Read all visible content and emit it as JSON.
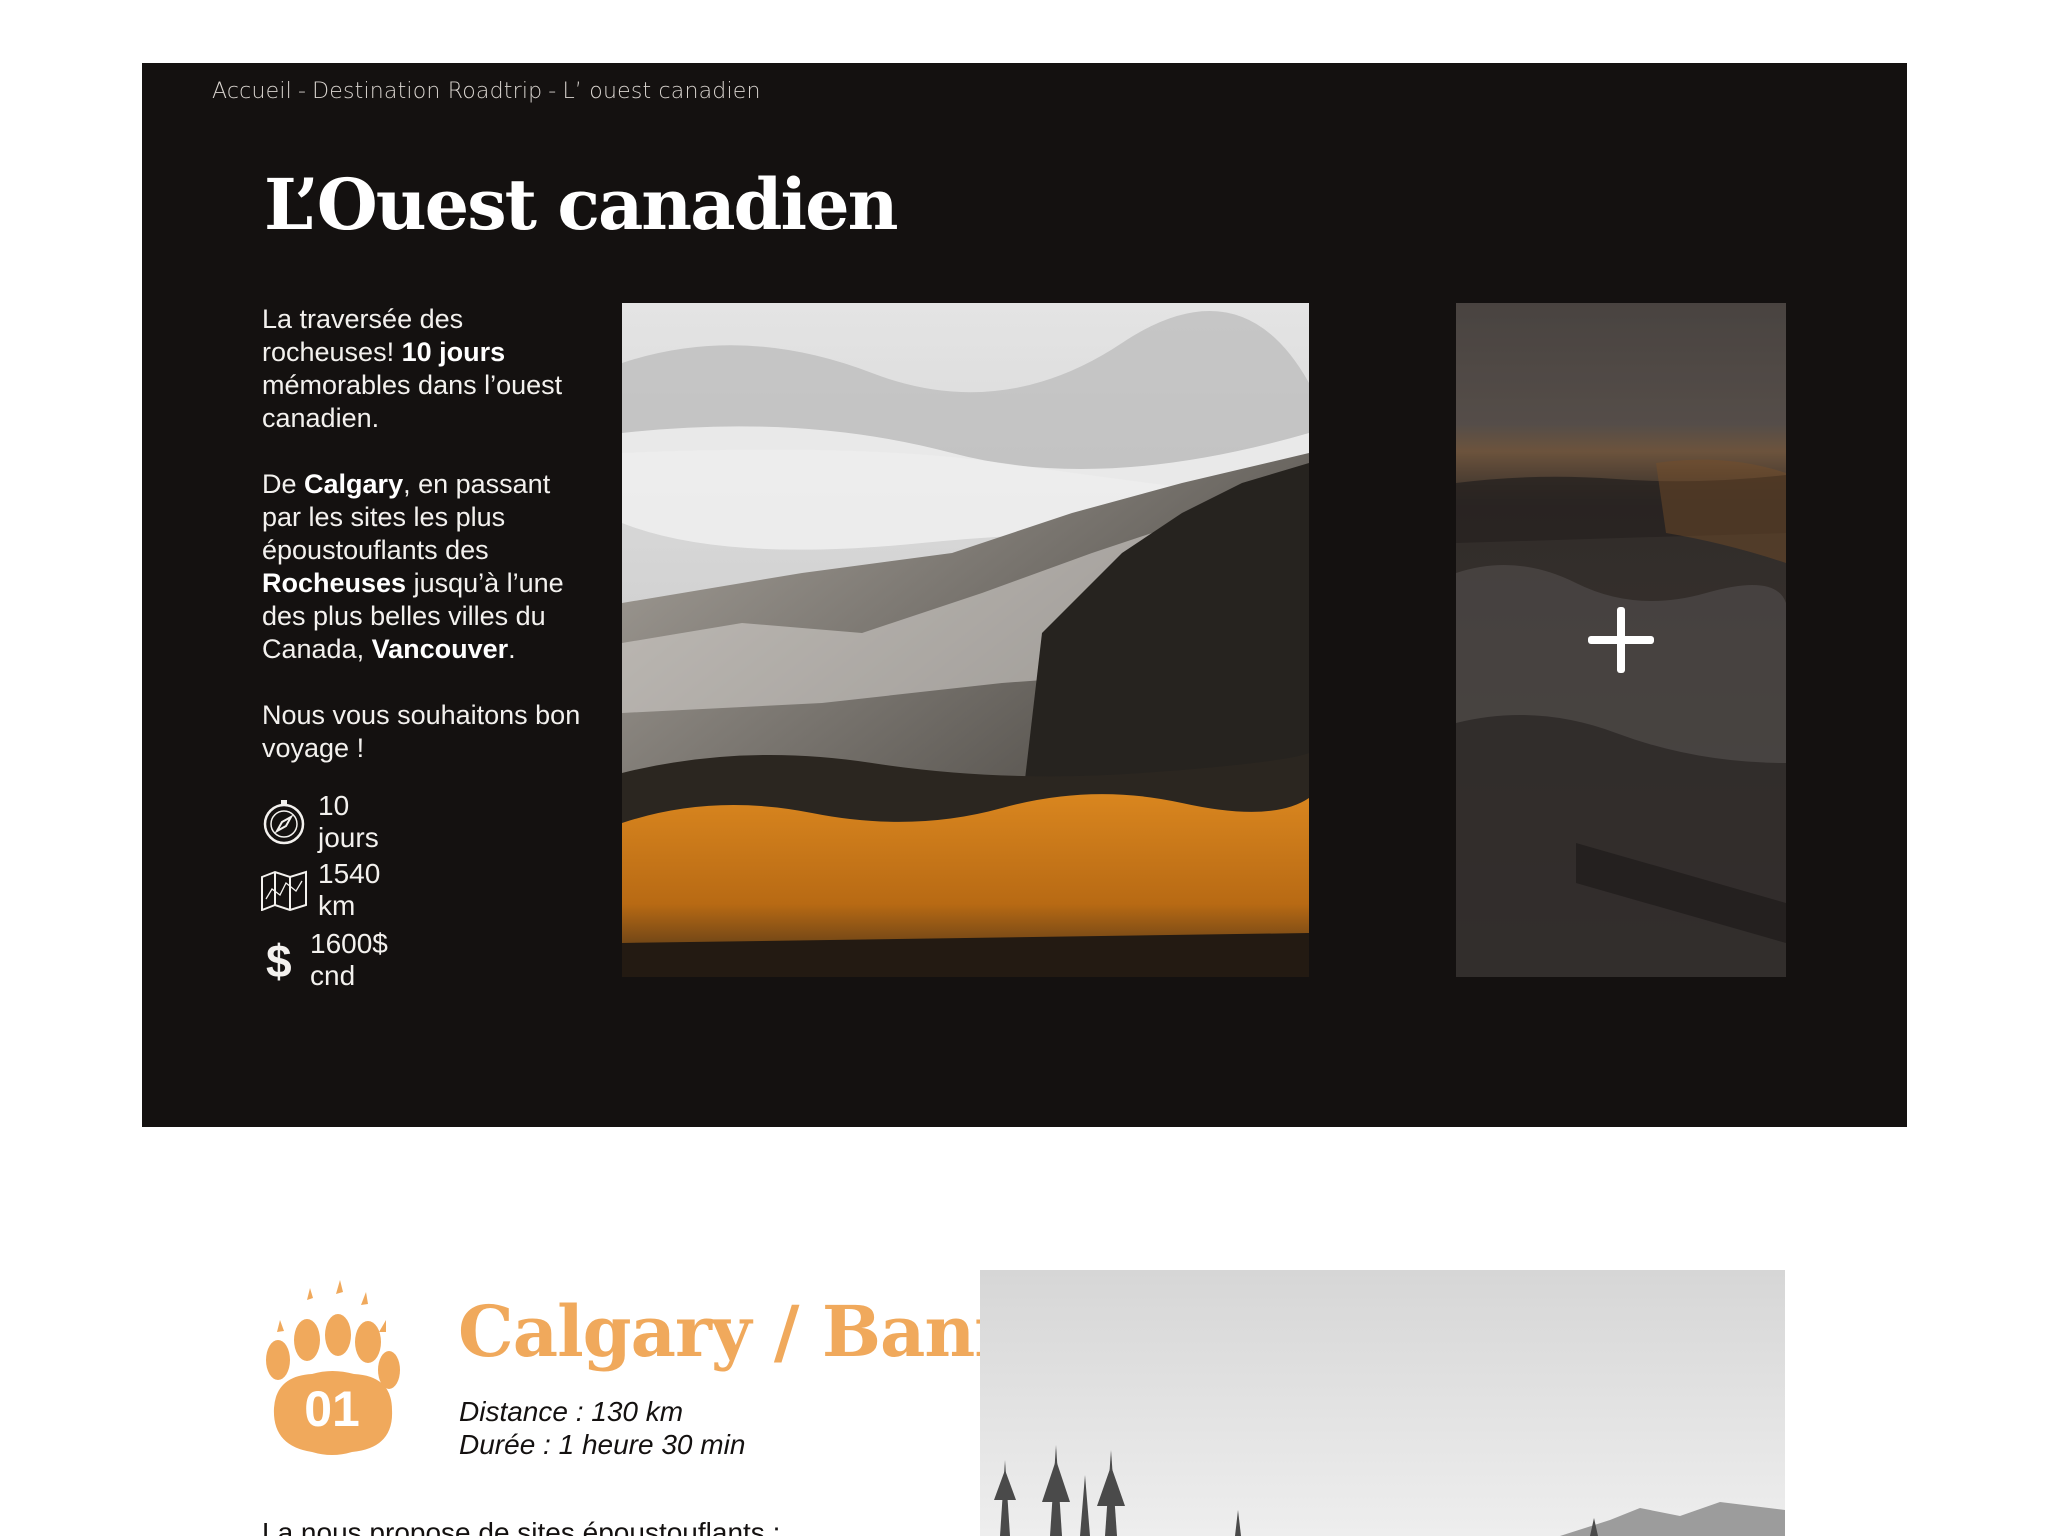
{
  "breadcrumb": {
    "items": [
      "Accueil",
      "Destination Roadtrip",
      "L’ ouest canadien"
    ],
    "separator": "-"
  },
  "hero": {
    "title": "L’Ouest canadien",
    "intro": {
      "p1_a": "La traversée des rocheuses! ",
      "p1_bold": "10 jours",
      "p1_b": " mémorables dans l’ouest canadien.",
      "p2_a": "De ",
      "p2_bold1": "Calgary",
      "p2_b": ", en passant par les sites les plus époustouflants des ",
      "p2_bold2": "Rocheuses",
      "p2_c": " jusqu’à l’une des plus belles villes du Canada, ",
      "p2_bold3": "Vancouver",
      "p2_d": ".",
      "p3": "Nous vous souhaitons bon voyage !"
    },
    "stats": [
      {
        "icon": "compass-icon",
        "label": "10 jours"
      },
      {
        "icon": "map-icon",
        "label": "1540 km"
      },
      {
        "icon": "dollar-icon",
        "label": "1600$ cnd"
      }
    ],
    "gallery_more_icon": "plus-icon"
  },
  "stage": {
    "number": "01",
    "badge_icon": "bear-paw-icon",
    "title": "Calgary / Banff",
    "distance": "Distance : 130 km",
    "duration": "Durée : 1 heure 30 min",
    "description_partial": "La nous propose de sites époustouflants :"
  },
  "colors": {
    "hero_bg": "#141110",
    "accent": "#f0a95c",
    "text_light": "#f3f1ee"
  }
}
